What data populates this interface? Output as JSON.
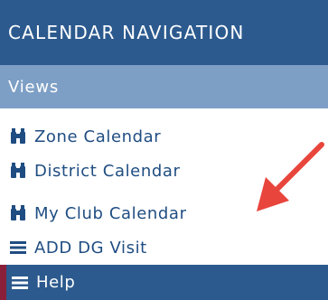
{
  "nav": {
    "title": "CALENDAR NAVIGATION",
    "section": "Views",
    "items": [
      {
        "label": "Zone Calendar",
        "icon": "binoculars-icon"
      },
      {
        "label": "District Calendar",
        "icon": "binoculars-icon"
      },
      {
        "label": "My Club Calendar",
        "icon": "binoculars-icon"
      },
      {
        "label": "ADD DG Visit",
        "icon": "list-icon"
      }
    ],
    "help": {
      "label": "Help",
      "icon": "list-icon"
    }
  },
  "colors": {
    "header_bg": "#2c5a8e",
    "section_bg": "#7d9ec5",
    "link_text": "#1f4d82",
    "help_accent": "#8a1f3a",
    "annotation_arrow": "#e8453c"
  }
}
